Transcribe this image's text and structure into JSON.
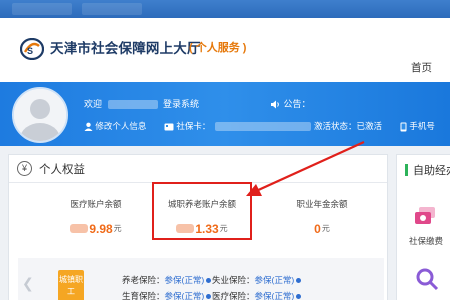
{
  "header": {
    "site_title": "天津市社会保障网上大厅",
    "site_sub": "( 个人服务 )",
    "home": "首页"
  },
  "user": {
    "welcome_prefix": "欢迎",
    "welcome_suffix": "登录系统",
    "notice": "公告：",
    "edit_info": "修改个人信息",
    "ssn_label": "社保卡：",
    "activation": "激活状态：已激活",
    "phone": "手机号"
  },
  "rights": {
    "title": "个人权益",
    "balances": [
      {
        "label": "医疗账户余额",
        "amount": "9.98",
        "unit": "元"
      },
      {
        "label": "城职养老账户余额",
        "amount": "1.33",
        "unit": "元"
      },
      {
        "label": "职业年金余额",
        "amount": "0",
        "unit": "元"
      }
    ],
    "badge": "城镇职工",
    "insurance": [
      {
        "name": "养老保险：",
        "status": "参保(正常)"
      },
      {
        "name": "失业保险：",
        "status": "参保(正常)"
      },
      {
        "name": "生育保险：",
        "status": "参保(正常)"
      },
      {
        "name": "医疗保险：",
        "status": "参保(正常)"
      }
    ]
  },
  "self_service": {
    "title": "自助经办",
    "items": [
      {
        "label": "社保缴费",
        "icon": "money-icon"
      },
      {
        "label": "",
        "icon": "search-icon"
      }
    ]
  },
  "colors": {
    "accent_blue": "#2f8fea",
    "amount_orange": "#f06a18",
    "highlight_red": "#e0201b",
    "status_blue": "#2f6ed0"
  }
}
